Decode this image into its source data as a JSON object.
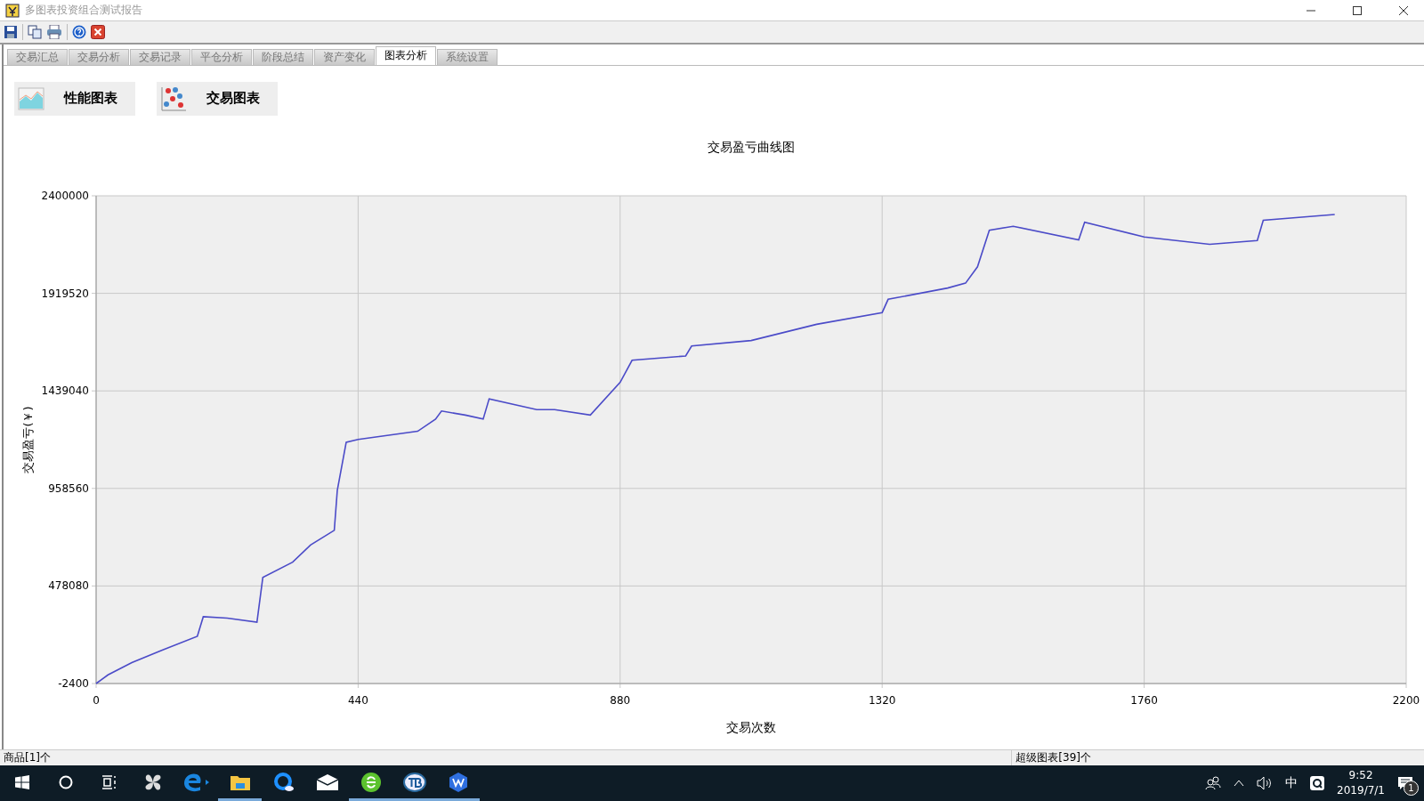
{
  "window": {
    "title": "多图表投资组合测试报告"
  },
  "tabs": [
    {
      "label": "交易汇总",
      "selected": false
    },
    {
      "label": "交易分析",
      "selected": false
    },
    {
      "label": "交易记录",
      "selected": false
    },
    {
      "label": "平仓分析",
      "selected": false
    },
    {
      "label": "阶段总结",
      "selected": false
    },
    {
      "label": "资产变化",
      "selected": false
    },
    {
      "label": "图表分析",
      "selected": true
    },
    {
      "label": "系统设置",
      "selected": false
    }
  ],
  "chart_buttons": [
    {
      "label": "性能图表",
      "kind": "area"
    },
    {
      "label": "交易图表",
      "kind": "scatter"
    }
  ],
  "chart": {
    "chart_data": {
      "type": "line",
      "title": "交易盈亏曲线图",
      "xlabel": "交易次数",
      "ylabel": "交易盈亏(￥)",
      "x": [
        0,
        20,
        60,
        110,
        170,
        180,
        220,
        270,
        280,
        330,
        360,
        400,
        405,
        420,
        440,
        540,
        570,
        580,
        620,
        650,
        660,
        740,
        770,
        830,
        880,
        900,
        990,
        1000,
        1100,
        1210,
        1320,
        1330,
        1430,
        1460,
        1480,
        1500,
        1540,
        1650,
        1660,
        1760,
        1870,
        1950,
        1960,
        2080
      ],
      "grid": true,
      "series": [
        {
          "color": "#4b4bc8",
          "values": [
            -2400,
            40000,
            100000,
            161000,
            230000,
            327000,
            320000,
            300000,
            520000,
            595000,
            680000,
            752000,
            950000,
            1186000,
            1200000,
            1240000,
            1300000,
            1340000,
            1320000,
            1300000,
            1400000,
            1347000,
            1347000,
            1320000,
            1481000,
            1590000,
            1611000,
            1660000,
            1687000,
            1767000,
            1825000,
            1890000,
            1946000,
            1970000,
            2050000,
            2230000,
            2250000,
            2183000,
            2270000,
            2197000,
            2161000,
            2180000,
            2280000,
            2308000
          ]
        }
      ],
      "xlim": [
        0,
        2200
      ],
      "ylim": [
        -2400,
        2400000
      ],
      "xticks": [
        0,
        440,
        880,
        1320,
        1760,
        2200
      ],
      "yticks": [
        -2400,
        478080,
        958560,
        1439040,
        1919520,
        2400000
      ]
    }
  },
  "status_bar": {
    "left": "商品[1]个",
    "right": "超级图表[39]个"
  },
  "taskbar": {
    "apps": [
      {
        "kind": "start",
        "active": false
      },
      {
        "kind": "search",
        "active": false
      },
      {
        "kind": "taskview",
        "active": false
      },
      {
        "kind": "pinwheel",
        "active": false
      },
      {
        "kind": "edge",
        "active": false
      },
      {
        "kind": "folder",
        "active": true
      },
      {
        "kind": "qbrowser",
        "active": false
      },
      {
        "kind": "mail",
        "active": false
      },
      {
        "kind": "greenie",
        "active": true
      },
      {
        "kind": "tb",
        "active": true
      },
      {
        "kind": "wps",
        "active": true
      }
    ],
    "ime": "中",
    "time": "9:52",
    "date": "2019/7/1",
    "notifications": "1"
  }
}
